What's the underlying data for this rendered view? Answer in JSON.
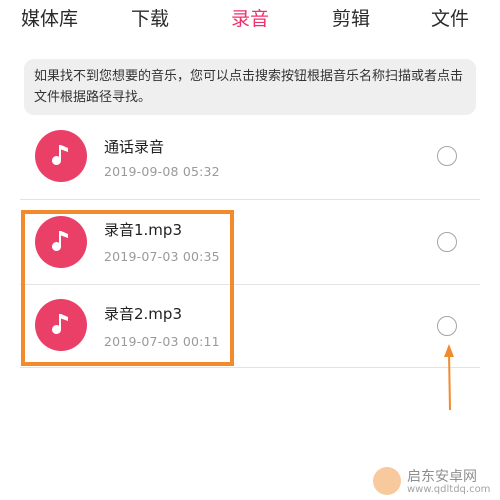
{
  "tabs": [
    {
      "label": "媒体库",
      "active": false
    },
    {
      "label": "下载",
      "active": false
    },
    {
      "label": "录音",
      "active": true
    },
    {
      "label": "剪辑",
      "active": false
    },
    {
      "label": "文件",
      "active": false
    }
  ],
  "info_text": "如果找不到您想要的音乐，您可以点击搜索按钮根据音乐名称扫描或者点击文件根据路径寻找。",
  "recordings": [
    {
      "name": "通话录音",
      "time": "2019-09-08  05:32",
      "selected": false
    },
    {
      "name": "录音1.mp3",
      "time": "2019-07-03  00:35",
      "selected": false
    },
    {
      "name": "录音2.mp3",
      "time": "2019-07-03  00:11",
      "selected": false
    }
  ],
  "icons": {
    "recording": "music-note-icon",
    "select": "radio-circle-icon"
  },
  "colors": {
    "accent": "#f0306a",
    "avatar": "#ea4068",
    "annotation": "#f28a2e"
  },
  "watermark": {
    "title": "启东安卓网",
    "url": "www.qdltdq.com"
  }
}
